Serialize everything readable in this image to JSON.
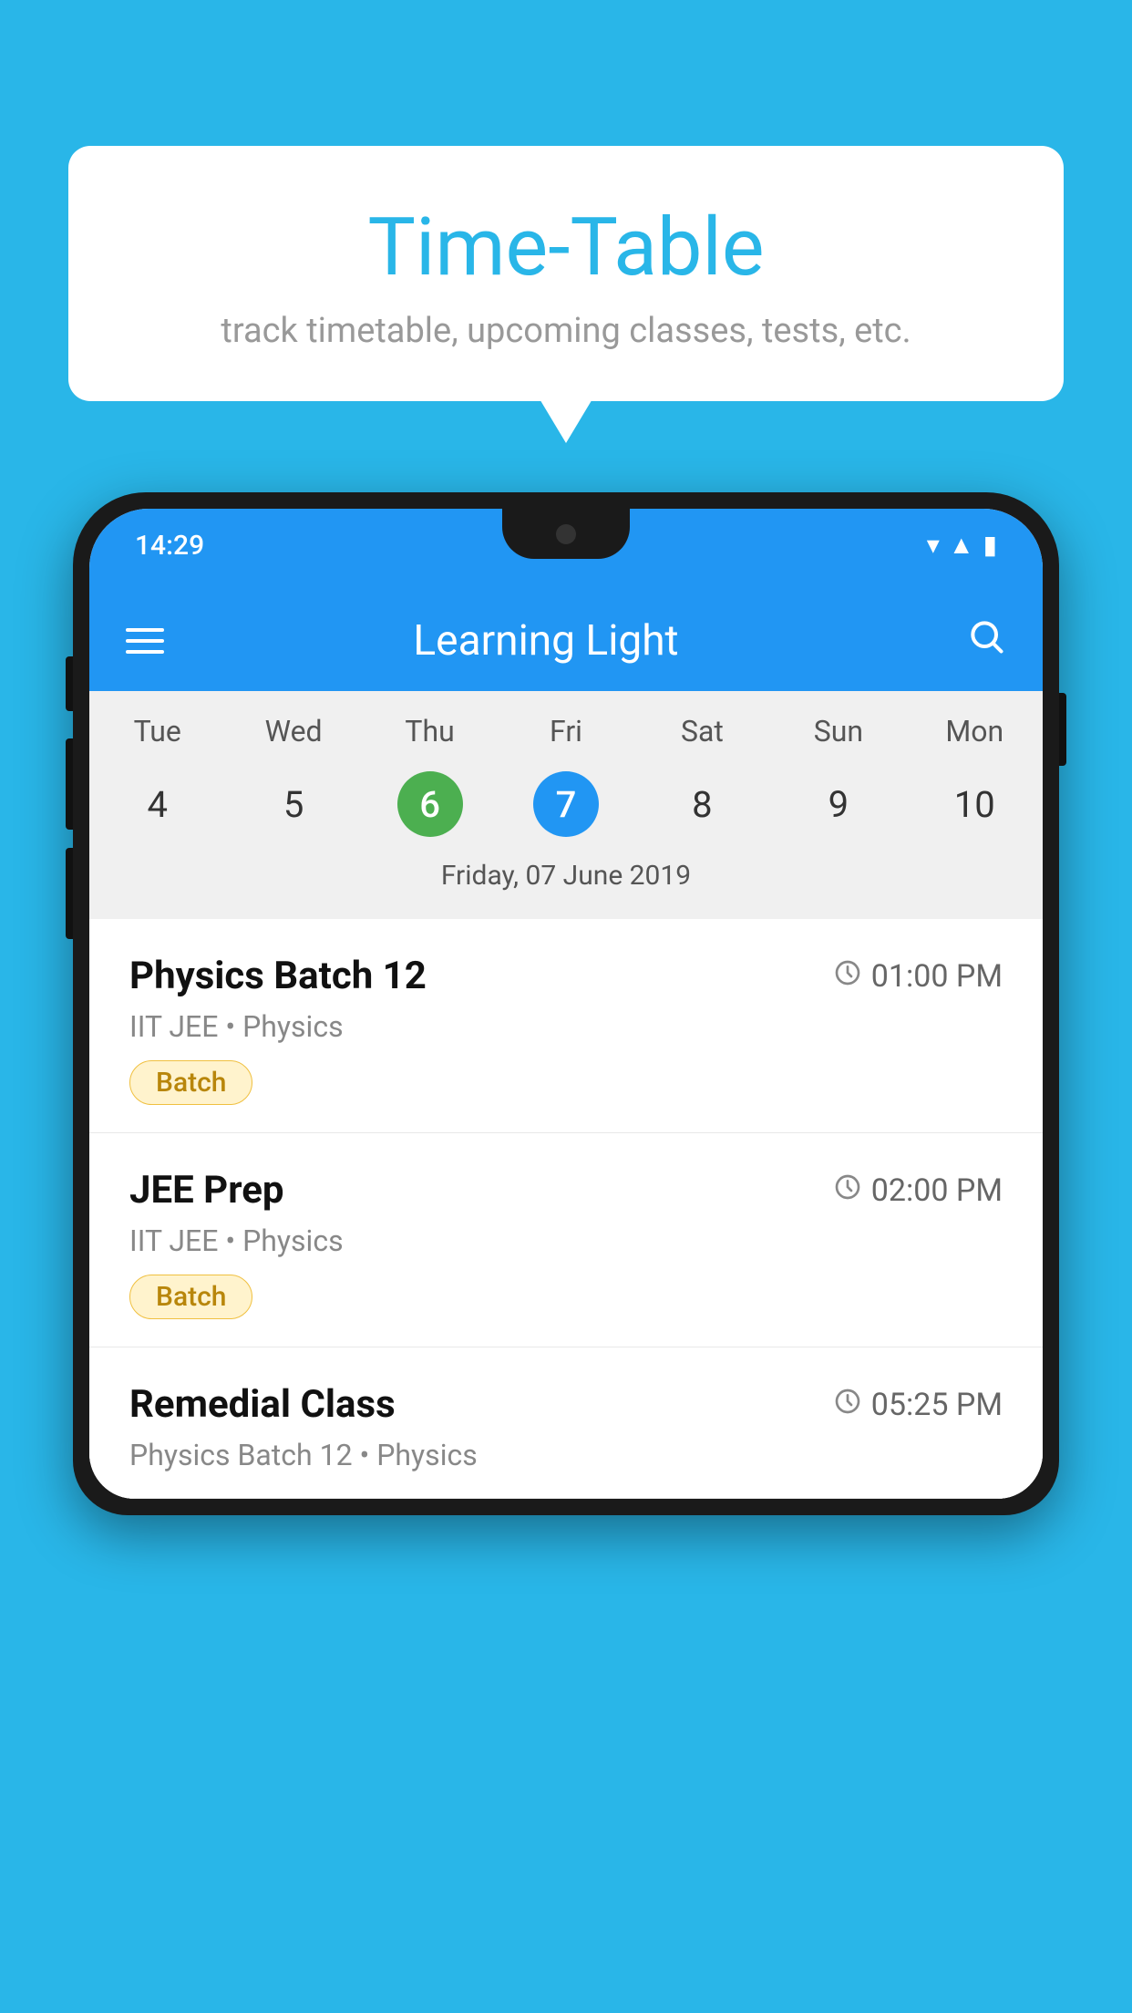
{
  "background_color": "#29B6E8",
  "speech_bubble": {
    "title": "Time-Table",
    "subtitle": "track timetable, upcoming classes, tests, etc."
  },
  "phone": {
    "status_bar": {
      "time": "14:29",
      "icons": [
        "wifi",
        "signal",
        "battery"
      ]
    },
    "app_bar": {
      "title": "Learning Light",
      "menu_icon": "menu",
      "search_icon": "search"
    },
    "calendar": {
      "days": [
        {
          "label": "Tue",
          "num": "4",
          "state": "normal"
        },
        {
          "label": "Wed",
          "num": "5",
          "state": "normal"
        },
        {
          "label": "Thu",
          "num": "6",
          "state": "today"
        },
        {
          "label": "Fri",
          "num": "7",
          "state": "selected"
        },
        {
          "label": "Sat",
          "num": "8",
          "state": "normal"
        },
        {
          "label": "Sun",
          "num": "9",
          "state": "normal"
        },
        {
          "label": "Mon",
          "num": "10",
          "state": "normal"
        }
      ],
      "selected_date_label": "Friday, 07 June 2019"
    },
    "schedule": [
      {
        "title": "Physics Batch 12",
        "time": "01:00 PM",
        "subtitle": "IIT JEE • Physics",
        "tag": "Batch"
      },
      {
        "title": "JEE Prep",
        "time": "02:00 PM",
        "subtitle": "IIT JEE • Physics",
        "tag": "Batch"
      },
      {
        "title": "Remedial Class",
        "time": "05:25 PM",
        "subtitle": "Physics Batch 12 • Physics",
        "tag": null
      }
    ]
  }
}
